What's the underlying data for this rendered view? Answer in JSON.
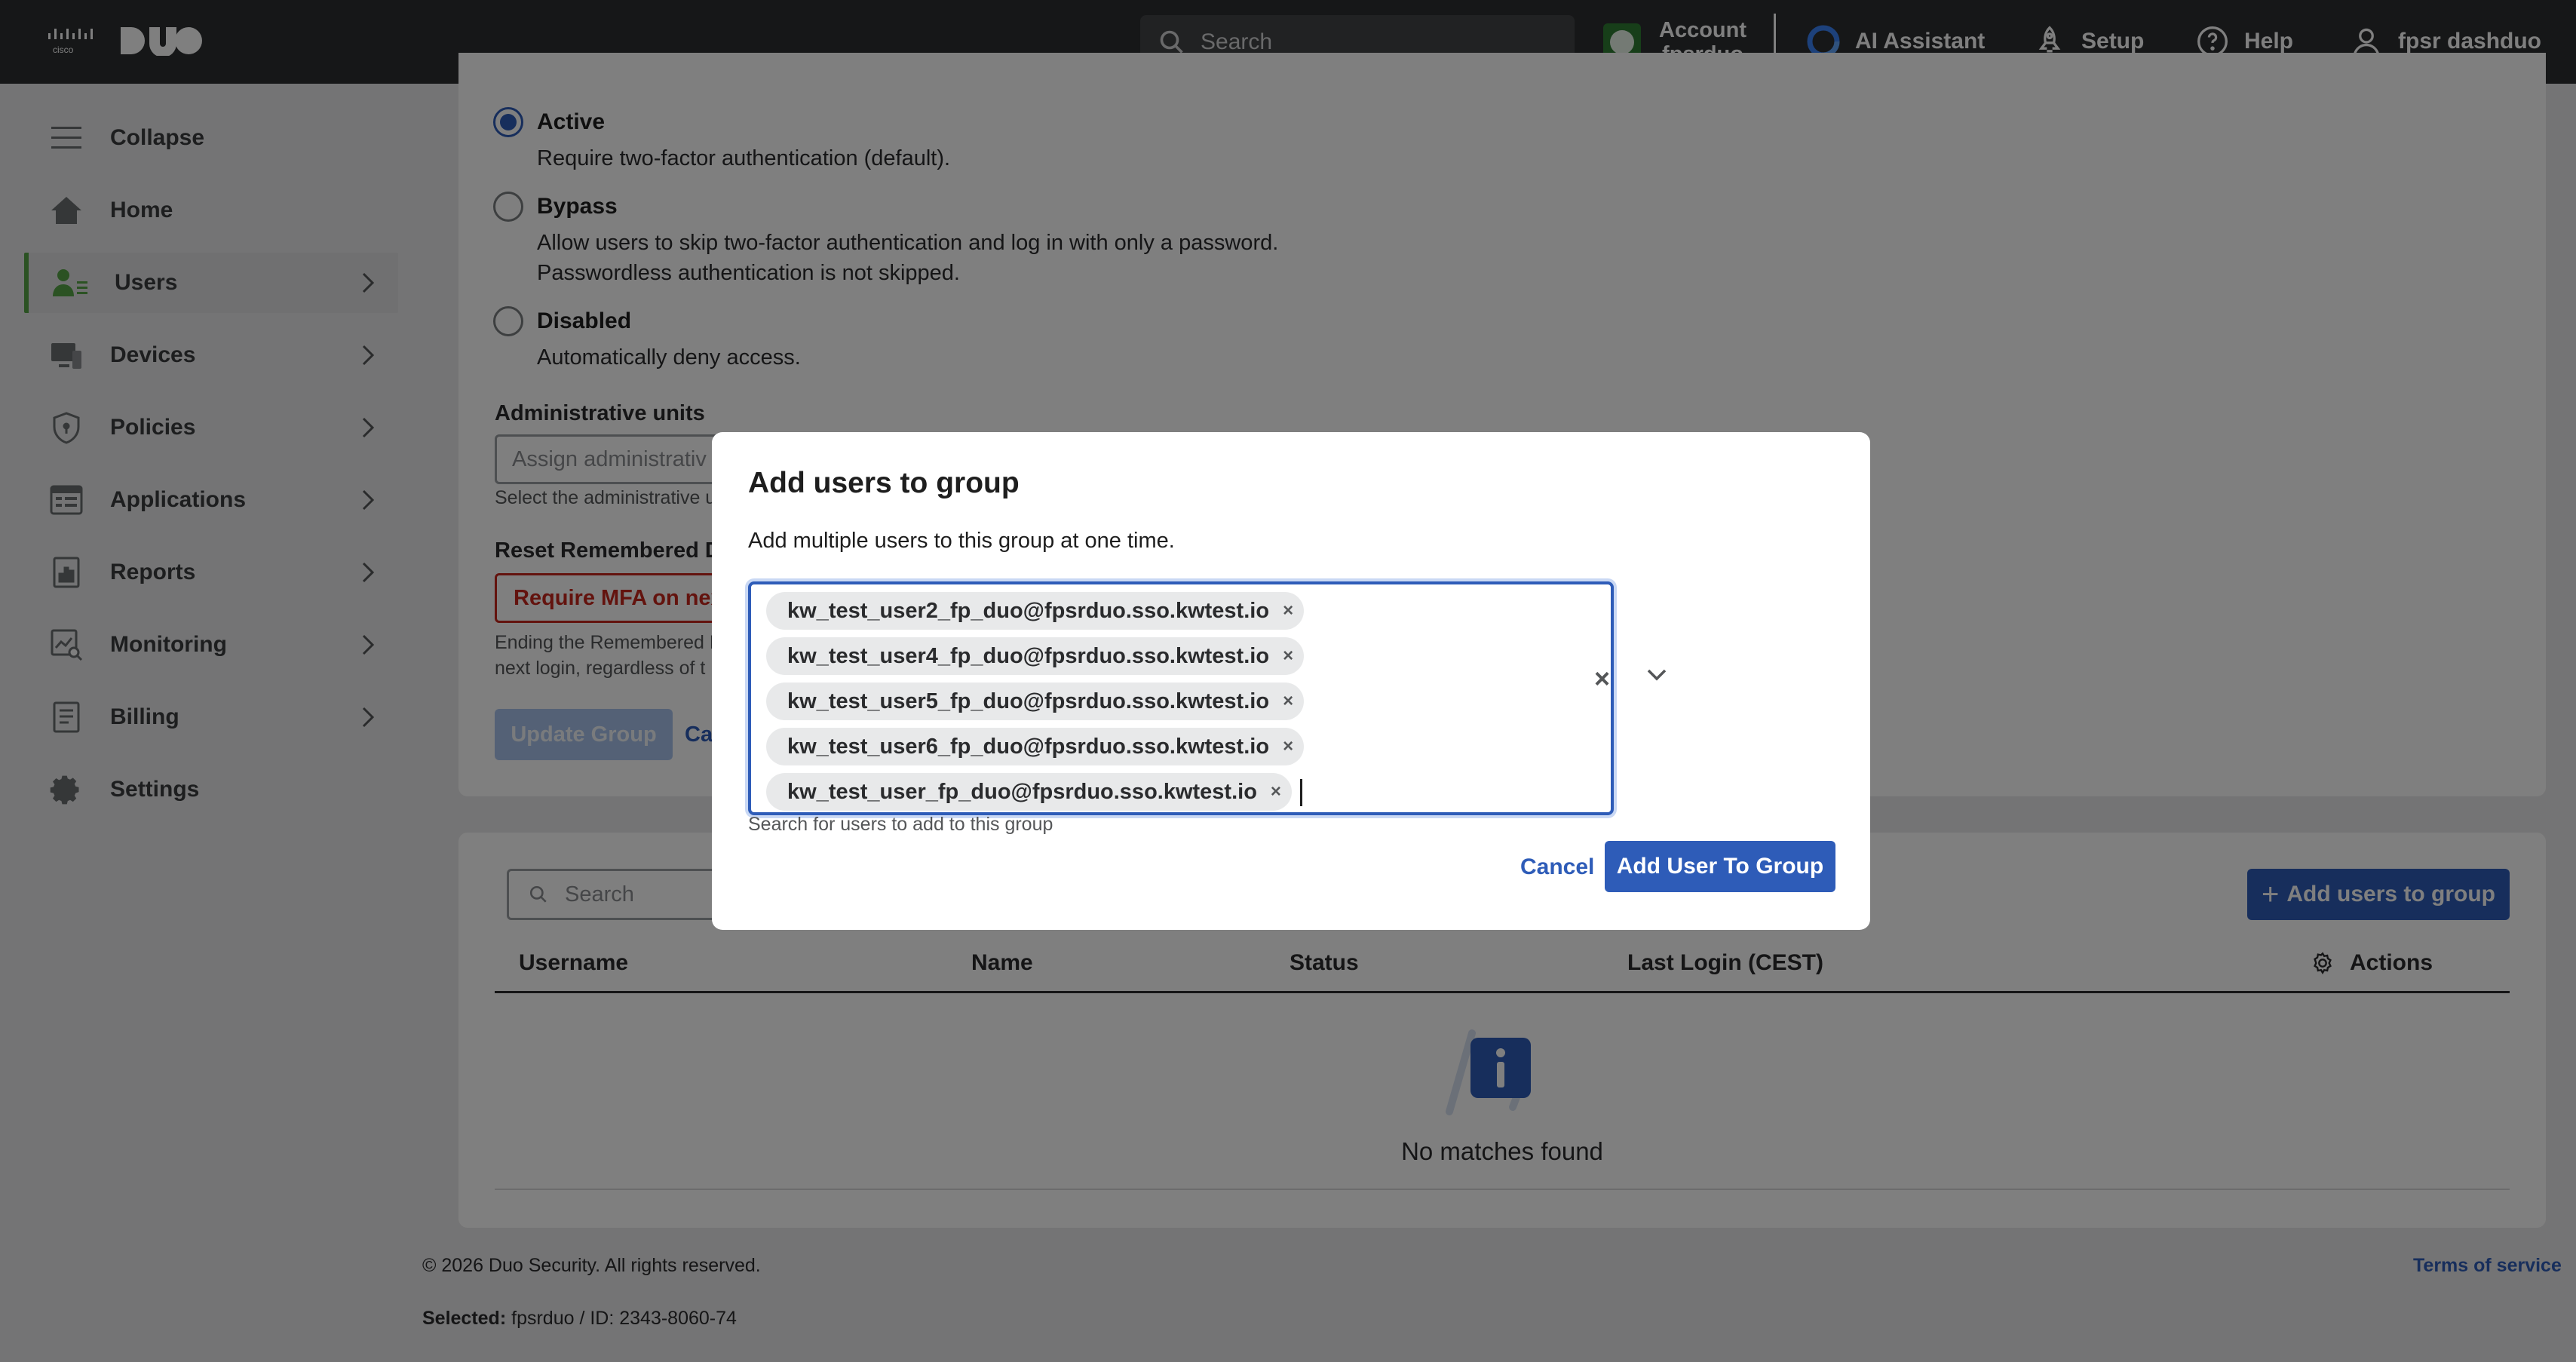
{
  "topbar": {
    "search_placeholder": "Search",
    "account_label": "Account",
    "account_name": "fpsrduo",
    "ai_assistant": "AI Assistant",
    "setup": "Setup",
    "help": "Help",
    "user": "fpsr dashduo"
  },
  "sidebar": {
    "items": [
      {
        "label": "Collapse"
      },
      {
        "label": "Home"
      },
      {
        "label": "Users"
      },
      {
        "label": "Devices"
      },
      {
        "label": "Policies"
      },
      {
        "label": "Applications"
      },
      {
        "label": "Reports"
      },
      {
        "label": "Monitoring"
      },
      {
        "label": "Billing"
      },
      {
        "label": "Settings"
      }
    ]
  },
  "status": {
    "active": {
      "label": "Active",
      "desc": "Require two-factor authentication (default)."
    },
    "bypass": {
      "label": "Bypass",
      "desc1": "Allow users to skip two-factor authentication and log in with only a password.",
      "desc2": "Passwordless authentication is not skipped."
    },
    "disabled": {
      "label": "Disabled",
      "desc": "Automatically deny access."
    }
  },
  "admin_units": {
    "label": "Administrative units",
    "placeholder": "Assign administrativ",
    "help": "Select the administrative u"
  },
  "reset": {
    "label": "Reset Remembered D",
    "button": "Require MFA on nex",
    "help1": "Ending the Remembered D",
    "help2": "next login, regardless of t"
  },
  "actions": {
    "update": "Update Group",
    "cancel": "Ca"
  },
  "members": {
    "search_placeholder": "Search",
    "add_button": "Add users to group",
    "columns": [
      "Username",
      "Name",
      "Status",
      "Last Login (CEST)",
      "Actions"
    ],
    "empty": "No matches found"
  },
  "footer": {
    "copyright": "© 2026 Duo Security. All rights reserved.",
    "selected_label": "Selected:",
    "selected_value": "fpsrduo / ID: 2343-8060-74",
    "terms": "Terms of service"
  },
  "modal": {
    "title": "Add users to group",
    "subtitle": "Add multiple users to this group at one time.",
    "chips": [
      "kw_test_user2_fp_duo@fpsrduo.sso.kwtest.io",
      "kw_test_user4_fp_duo@fpsrduo.sso.kwtest.io",
      "kw_test_user5_fp_duo@fpsrduo.sso.kwtest.io",
      "kw_test_user6_fp_duo@fpsrduo.sso.kwtest.io",
      "kw_test_user_fp_duo@fpsrduo.sso.kwtest.io"
    ],
    "chip_remove": "×",
    "clear": "×",
    "help": "Search for users to add to this group",
    "cancel": "Cancel",
    "submit": "Add User To Group"
  }
}
